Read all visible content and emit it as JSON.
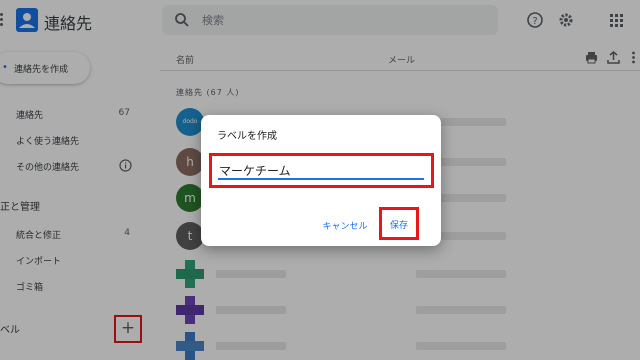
{
  "header": {
    "app_title": "連絡先",
    "search_placeholder": "検索",
    "icons": [
      "menu-icon",
      "contacts-logo-icon",
      "search-icon",
      "help-icon",
      "settings-icon",
      "apps-grid-icon"
    ]
  },
  "sidebar": {
    "create_label": "連絡先を作成",
    "items": [
      {
        "label": "連絡先",
        "count": "67"
      },
      {
        "label": "よく使う連絡先",
        "count": ""
      },
      {
        "label": "その他の連絡先",
        "count": ""
      }
    ],
    "manage_heading": "正と管理",
    "manage_items": [
      {
        "label": "統合と修正",
        "count": "4"
      },
      {
        "label": "インポート",
        "count": ""
      },
      {
        "label": "ゴミ箱",
        "count": ""
      }
    ],
    "labels_heading": "ベル",
    "add_label_symbol": "+"
  },
  "main": {
    "col_name": "名前",
    "col_email": "メール",
    "contacts_count_line": "連絡先 (67 人)",
    "rows": [
      {
        "avatar_text": "dodo",
        "color": "#1f8fd0"
      },
      {
        "avatar_text": "h",
        "color": "#8d6e63"
      },
      {
        "avatar_text": "m",
        "color": "#2e7d32"
      },
      {
        "avatar_text": "t",
        "color": "#616161"
      }
    ]
  },
  "dialog": {
    "title": "ラベルを作成",
    "input_value": "マーケチーム",
    "cancel_label": "キャンセル",
    "save_label": "保存"
  },
  "colors": {
    "accent": "#1a73e8",
    "highlight": "#e8151b",
    "scrim": "rgba(0,0,0,0.32)"
  }
}
